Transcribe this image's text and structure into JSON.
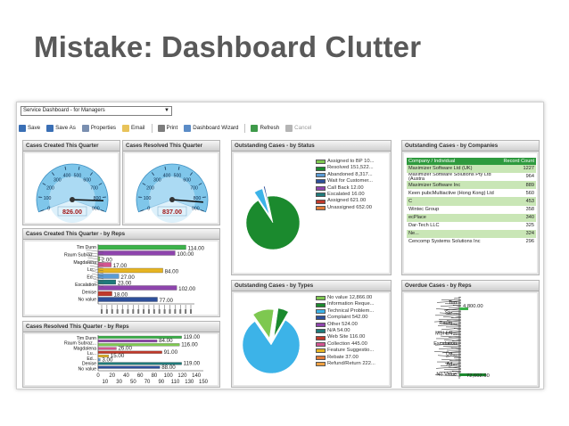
{
  "slide_title": "Mistake: Dashboard Clutter",
  "dashboard_select": {
    "value": "Service Dashboard - for Managers",
    "arrow": "▼"
  },
  "toolbar": [
    {
      "label": "Save",
      "icon": "save-icon",
      "color": "#3a6fb5",
      "enabled": true
    },
    {
      "label": "Save As",
      "icon": "save-as-icon",
      "color": "#3a6fb5",
      "enabled": true
    },
    {
      "label": "Properties",
      "icon": "properties-icon",
      "color": "#7a8fb0",
      "enabled": true
    },
    {
      "label": "Email",
      "icon": "email-icon",
      "color": "#e8c35a",
      "enabled": true
    },
    {
      "label": "Print",
      "icon": "print-icon",
      "color": "#7d7d7d",
      "enabled": true
    },
    {
      "label": "Dashboard Wizard",
      "icon": "wizard-icon",
      "color": "#5b8cc7",
      "enabled": true
    },
    {
      "label": "Refresh",
      "icon": "refresh-icon",
      "color": "#3f9a4a",
      "enabled": true
    },
    {
      "label": "Cancel",
      "icon": "cancel-icon",
      "color": "#b5b5b5",
      "enabled": false
    }
  ],
  "panels": {
    "gauge_created": {
      "title": "Cases Created This Quarter",
      "value": 826.0,
      "readout": "826.00"
    },
    "gauge_resolved": {
      "title": "Cases Resolved This Quarter",
      "value": 837.0,
      "readout": "837.00"
    },
    "gauge_ticks": [
      "0",
      "100",
      "200",
      "300",
      "400",
      "500",
      "600",
      "700",
      "800",
      "900"
    ],
    "created_by_reps": {
      "title": "Cases Created This Quarter - by Reps"
    },
    "resolved_by_reps": {
      "title": "Cases Resolved This Quarter - by Reps"
    },
    "by_status": {
      "title": "Outstanding Cases - by Status"
    },
    "by_companies": {
      "title": "Outstanding Cases - by Companies"
    },
    "by_types": {
      "title": "Outstanding Cases - by Types"
    },
    "overdue_by_reps": {
      "title": "Overdue Cases - by Reps"
    }
  },
  "status_legend": [
    {
      "label": "Assigned to BP 10...",
      "color": "#7ec850"
    },
    {
      "label": "Resolved 151,522...",
      "color": "#1b8a2e"
    },
    {
      "label": "Abandoned 8,317...",
      "color": "#5b9bd5"
    },
    {
      "label": "Wait for Customer...",
      "color": "#2d4f9a"
    },
    {
      "label": "Call Back 12.00",
      "color": "#8e44ad"
    },
    {
      "label": "Escalated 16.00",
      "color": "#1f7a7a"
    },
    {
      "label": "Assigned 621.00",
      "color": "#c0392b"
    },
    {
      "label": "Unassigned 652.00",
      "color": "#e07b39"
    }
  ],
  "types_legend": [
    {
      "label": "No value 12,866.00",
      "color": "#7ec850"
    },
    {
      "label": "Information Reque...",
      "color": "#1b8a2e"
    },
    {
      "label": "Technical Problem...",
      "color": "#3cb3e8"
    },
    {
      "label": "Complaint 542.00",
      "color": "#2d4f9a"
    },
    {
      "label": "Other 524.00",
      "color": "#8e44ad"
    },
    {
      "label": "N/A 54.00",
      "color": "#1f7a7a"
    },
    {
      "label": "Web Site 116.00",
      "color": "#c0392b"
    },
    {
      "label": "Collection 445.00",
      "color": "#d35490"
    },
    {
      "label": "Feature Suggestio...",
      "color": "#e6b422"
    },
    {
      "label": "Rebate 37.00",
      "color": "#e07b39"
    },
    {
      "label": "Refund/Return 222...",
      "color": "#f0a040"
    }
  ],
  "companies_table": {
    "headers": [
      "Company / Individual",
      "Record Count"
    ],
    "rows": [
      {
        "company": "Maximizer Software Ltd (UK)",
        "count": "1227"
      },
      {
        "company": "Maximizer Software Solutions Pty Ltd (Austra",
        "count": "964"
      },
      {
        "company": "Maximizer Software Inc",
        "count": "889"
      },
      {
        "company": "Keen pubcMultiactive (Hong Kong) Ltd",
        "count": "560"
      },
      {
        "company": "C",
        "count": "453"
      },
      {
        "company": "Wintec Group",
        "count": "358"
      },
      {
        "company": "ecPlace",
        "count": "340"
      },
      {
        "company": "Dar-Tech LLC",
        "count": "325"
      },
      {
        "company": "Ne...",
        "count": "324"
      },
      {
        "company": "Cencomp Systems Solutions Inc",
        "count": "296"
      }
    ]
  },
  "chart_data": [
    {
      "type": "gauge",
      "title": "Cases Created This Quarter",
      "ylim": [
        0,
        900
      ],
      "value": 826.0
    },
    {
      "type": "gauge",
      "title": "Cases Resolved This Quarter",
      "ylim": [
        0,
        900
      ],
      "value": 837.0
    },
    {
      "type": "bar",
      "orientation": "horizontal",
      "title": "Cases Created This Quarter - by Reps",
      "categories": [
        "Tim Dunn",
        "Raum Subraz...",
        "Magdalena",
        "Lu...",
        "Ed...",
        "Escalation",
        "Denise",
        "No value"
      ],
      "values": [
        114.0,
        100.0,
        2.0,
        17.0,
        84.0,
        27.0,
        23.0,
        102.0,
        18.0,
        77.0
      ],
      "data_labels": [
        "114.00",
        "100.00",
        "2.00",
        "17.00",
        "84.00",
        "27.00",
        "23.00",
        "102.00",
        "18.00",
        "77.00"
      ],
      "colors": [
        "#3cb34a",
        "#8e44ad",
        "#7ec850",
        "#d35490",
        "#e6b422",
        "#5b9bd5",
        "#1f7a7a",
        "#8e44ad",
        "#c0392b",
        "#2d4f9a"
      ]
    },
    {
      "type": "bar",
      "orientation": "horizontal",
      "title": "Cases Resolved This Quarter - by Reps",
      "categories": [
        "Tim Dunn",
        "Raum Subraz...",
        "Magdalena",
        "Lu...",
        "Ed...",
        "Denise",
        "No value"
      ],
      "values": [
        119.0,
        84.0,
        116.0,
        26.0,
        91.0,
        15.0,
        3.0,
        119.0,
        88.0
      ],
      "data_labels": [
        "119.00",
        "84.00",
        "116.00",
        "26.00",
        "91.00",
        "15.00",
        "3.00",
        "119.00",
        "88.00"
      ],
      "colors": [
        "#3cb34a",
        "#8e44ad",
        "#7ec850",
        "#d35490",
        "#c0392b",
        "#e6b422",
        "#5b9bd5",
        "#1f7a7a",
        "#2d4f9a"
      ],
      "xticks_major": [
        "0",
        "20",
        "40",
        "60",
        "80",
        "100",
        "120",
        "140"
      ],
      "xticks_minor": [
        "10",
        "30",
        "50",
        "70",
        "90",
        "110",
        "130",
        "150"
      ],
      "xlim": [
        0,
        150
      ]
    },
    {
      "type": "pie",
      "title": "Outstanding Cases - by Status",
      "labels": [
        "Resolved",
        "Abandoned",
        "Other"
      ],
      "values": [
        151522,
        8317,
        1300
      ],
      "colors": [
        "#1b8a2e",
        "#3cb3e8",
        "#2d4f9a"
      ]
    },
    {
      "type": "pie",
      "title": "Outstanding Cases - by Types",
      "labels": [
        "Technical Problem",
        "No value",
        "Other"
      ],
      "values": [
        82,
        12,
        6
      ],
      "colors": [
        "#3cb3e8",
        "#7ec850",
        "#1b8a2e"
      ]
    },
    {
      "type": "bar",
      "orientation": "horizontal",
      "title": "Overdue Cases - by Reps",
      "categories": [
        "Tim",
        "Ste...",
        "Raum...",
        "MSI EN...",
        "Escalation",
        "De...",
        "Ad...",
        "No Value"
      ],
      "data_labels": [
        "4,800.00",
        "72,602.00"
      ]
    }
  ]
}
